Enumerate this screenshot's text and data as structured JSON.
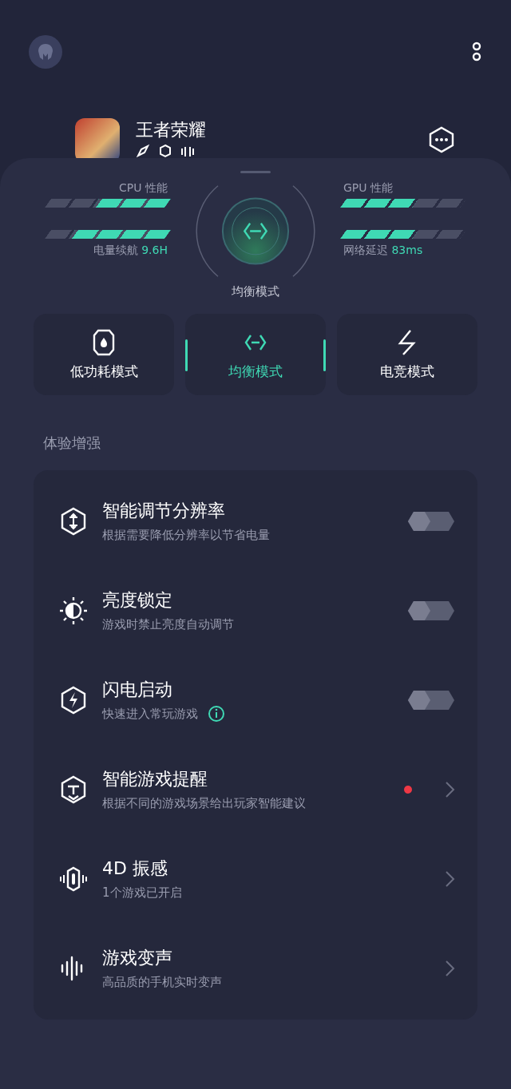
{
  "header": {
    "game": {
      "title": "王者荣耀"
    }
  },
  "performance": {
    "cpu": {
      "label": "CPU 性能",
      "level": 0.6
    },
    "battery": {
      "label": "电量续航",
      "value": "9.6H",
      "level": 0.8
    },
    "gpu": {
      "label": "GPU 性能",
      "level": 0.6
    },
    "network": {
      "label": "网络延迟",
      "value": "83ms",
      "level": 0.6
    },
    "current_mode": "均衡模式"
  },
  "modes": [
    {
      "label": "低功耗模式",
      "kind": "power-saving",
      "selected": false
    },
    {
      "label": "均衡模式",
      "kind": "balanced",
      "selected": true
    },
    {
      "label": "电竞模式",
      "kind": "esports",
      "selected": false
    }
  ],
  "section_title": "体验增强",
  "settings": [
    {
      "title": "智能调节分辨率",
      "subtitle": "根据需要降低分辨率以节省电量",
      "kind": "toggle",
      "on": false
    },
    {
      "title": "亮度锁定",
      "subtitle": "游戏时禁止亮度自动调节",
      "kind": "toggle",
      "on": false
    },
    {
      "title": "闪电启动",
      "subtitle": "快速进入常玩游戏",
      "kind": "toggle",
      "on": false,
      "info": true
    },
    {
      "title": "智能游戏提醒",
      "subtitle": "根据不同的游戏场景给出玩家智能建议",
      "kind": "link",
      "badge": true
    },
    {
      "title": "4D 振感",
      "subtitle": "1个游戏已开启",
      "kind": "link",
      "badge": false
    },
    {
      "title": "游戏变声",
      "subtitle": "高品质的手机实时变声",
      "kind": "link",
      "badge": false
    }
  ]
}
